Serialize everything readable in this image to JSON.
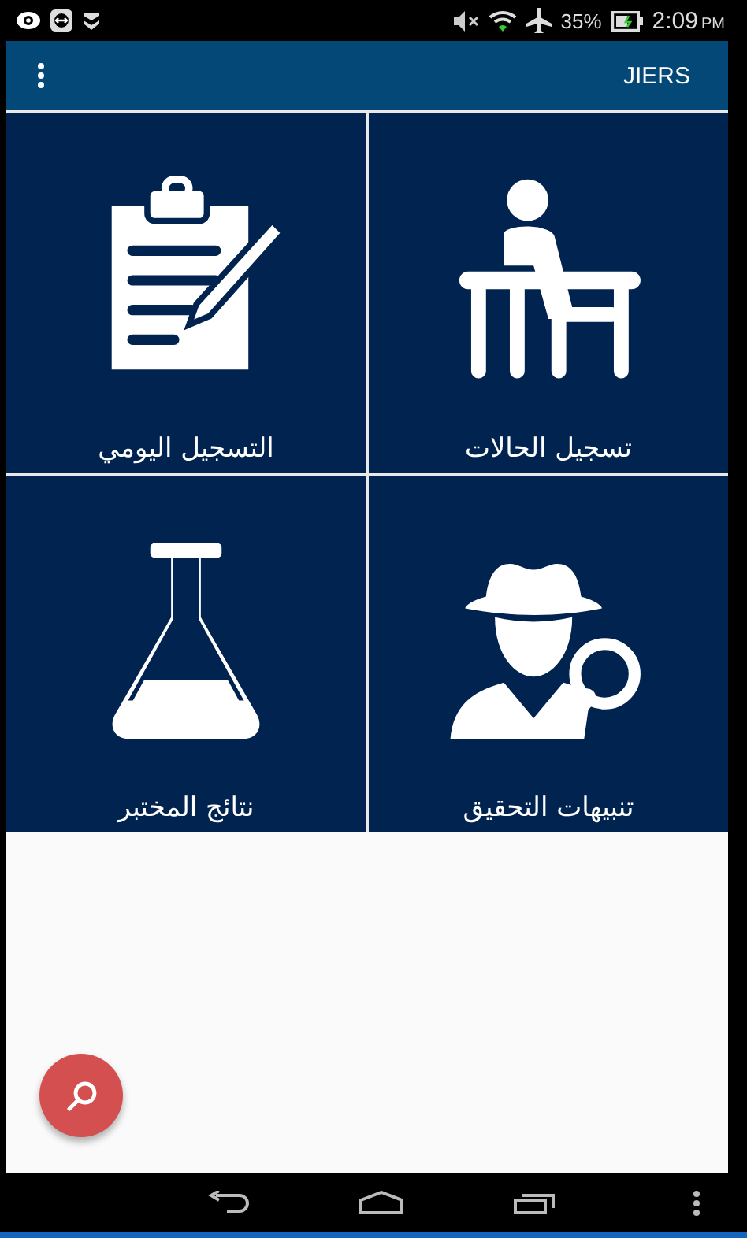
{
  "status_bar": {
    "battery": "35%",
    "time": "2:09",
    "time_suffix": "PM"
  },
  "app_bar": {
    "title": "JIERS"
  },
  "tiles": [
    {
      "kind": "desk",
      "label": "تسجيل الحالات"
    },
    {
      "kind": "clipboard",
      "label": "التسجيل اليومي"
    },
    {
      "kind": "detective",
      "label": "تنبيهات التحقيق"
    },
    {
      "kind": "flask",
      "label": "نتائج المختبر"
    }
  ]
}
